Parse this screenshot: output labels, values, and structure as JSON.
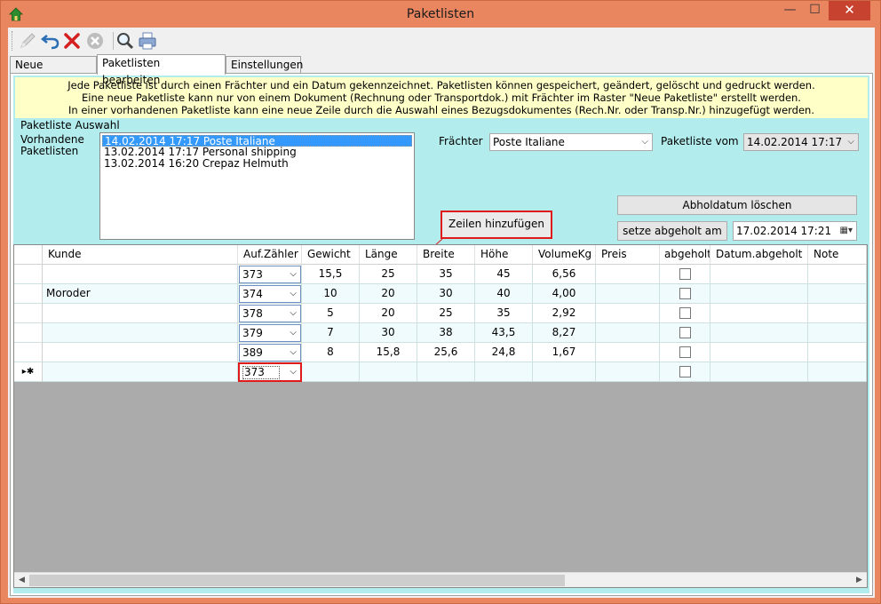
{
  "window": {
    "title": "Paketlisten",
    "close_glyph": "✕",
    "min_glyph": "—",
    "max_glyph": "☐"
  },
  "toolbar": {
    "icons": [
      "pencil-icon",
      "undo-icon",
      "delete-icon",
      "cancel-icon",
      "search-icon",
      "print-icon"
    ]
  },
  "tabs": [
    "Neue Paketliste",
    "Paketlisten bearbeiten",
    "Einstellungen"
  ],
  "active_tab": "Paketlisten bearbeiten",
  "info": {
    "line1": "Jede Paketliste ist durch einen Frächter und ein Datum gekennzeichnet. Paketlisten können gespeichert, geändert, gelöscht und gedruckt werden.",
    "line2": "Eine neue Paketliste kann nur von einem Dokument (Rechnung oder Transportdok.) mit Frächter im Raster \"Neue Paketliste\" erstellt werden.",
    "line3": "In einer vorhandenen Paketliste kann eine neue Zeile durch die Auswahl eines Bezugsdokumentes (Rech.Nr. oder Transp.Nr.) hinzugefügt werden."
  },
  "selection": {
    "group_label": "Paketliste Auswahl",
    "list_label_1": "Vorhandene",
    "list_label_2": "Paketlisten",
    "items": [
      "14.02.2014 17:17 Poste Italiane",
      "13.02.2014 17:17 Personal shipping",
      "13.02.2014 16:20 Crepaz Helmuth"
    ],
    "selected_index": 0
  },
  "carrier": {
    "label": "Frächter",
    "value": "Poste Italiane"
  },
  "list_date": {
    "label": "Paketliste vom",
    "value": "14.02.2014 17:17"
  },
  "buttons": {
    "clear_pickup": "Abholdatum löschen",
    "set_pickup": "setze abgeholt am",
    "add_rows": "Zeilen hinzufügen"
  },
  "pickup_date": "17.02.2014 17:21",
  "grid": {
    "columns": [
      "Kunde",
      "Auf.Zähler",
      "Gewicht",
      "Länge",
      "Breite",
      "Höhe",
      "VolumeKg",
      "Preis",
      "abgeholt",
      "Datum.abgeholt",
      "Note"
    ],
    "rows": [
      {
        "kunde": "",
        "zaehler": "373",
        "gewicht": "15,5",
        "laenge": "25",
        "breite": "35",
        "hoehe": "45",
        "volume": "6,56"
      },
      {
        "kunde": "Moroder",
        "zaehler": "374",
        "gewicht": "10",
        "laenge": "20",
        "breite": "30",
        "hoehe": "40",
        "volume": "4,00"
      },
      {
        "kunde": "",
        "zaehler": "378",
        "gewicht": "5",
        "laenge": "20",
        "breite": "25",
        "hoehe": "35",
        "volume": "2,92"
      },
      {
        "kunde": "",
        "zaehler": "379",
        "gewicht": "7",
        "laenge": "30",
        "breite": "38",
        "hoehe": "43,5",
        "volume": "8,27"
      },
      {
        "kunde": "",
        "zaehler": "389",
        "gewicht": "8",
        "laenge": "15,8",
        "breite": "25,6",
        "hoehe": "24,8",
        "volume": "1,67"
      }
    ],
    "new_row": {
      "marker": "▸✱",
      "zaehler": "373"
    }
  },
  "colors": {
    "title_bar": "#e9855f",
    "panel_bg": "#b2ecec",
    "info_bg": "#ffffc8",
    "highlight": "#e01a1a",
    "selection": "#3399ff"
  }
}
